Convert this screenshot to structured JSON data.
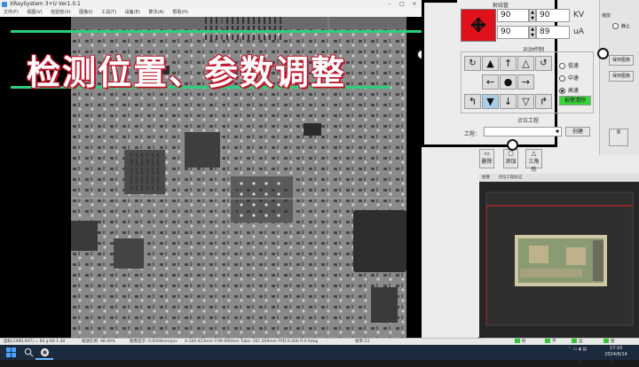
{
  "app": {
    "title": "XRaySystem 3+U Ver1.0.1",
    "menu": [
      "文件(F)",
      "视图(V)",
      "检验管(X)",
      "图像(I)",
      "工具(T)",
      "设备(E)",
      "算法(A)",
      "帮助(H)"
    ]
  },
  "overlay": {
    "title": "检测位置、参数调整"
  },
  "tube": {
    "group_title": "射线管",
    "kv_value": "90",
    "kv_set": "90",
    "kv_unit": "KV",
    "ua_value": "90",
    "ua_set": "89",
    "ua_unit": "uA",
    "status_color": "#e0111b"
  },
  "motion": {
    "group_title": "运动控制",
    "speed_options": [
      "低速",
      "中速",
      "高速"
    ],
    "speed_selected": "高速",
    "emergency_label": "报警清除",
    "emergency_color": "#39d43a"
  },
  "point": {
    "group_title": "点位工程",
    "project_label": "工程：",
    "create_label": "创建",
    "buttons": [
      "删除",
      "添加",
      "三角形"
    ]
  },
  "right_edge": {
    "labels": [
      "播放",
      "静止",
      "保存图像",
      "保存图像"
    ]
  },
  "camera": {
    "tabs": [
      "图像",
      "点位工程标记"
    ]
  },
  "statusbar": {
    "coords": "鼠标(1490,947) = 60 g 60 1 40",
    "zoom": "缩放比例: 48.00%",
    "scale": "图像显示: 0.0008mm/pix",
    "stage": "X:100.453mm  Y:99.900mm  Tube:-101.609mm  FPD:0.000  R:0.0deg",
    "fps": "帧率:23",
    "indicators": [
      "射线管",
      "平板",
      "运动系统",
      "图像系统"
    ]
  },
  "taskbar": {
    "time": "17:10",
    "date": "2024/6/14"
  }
}
